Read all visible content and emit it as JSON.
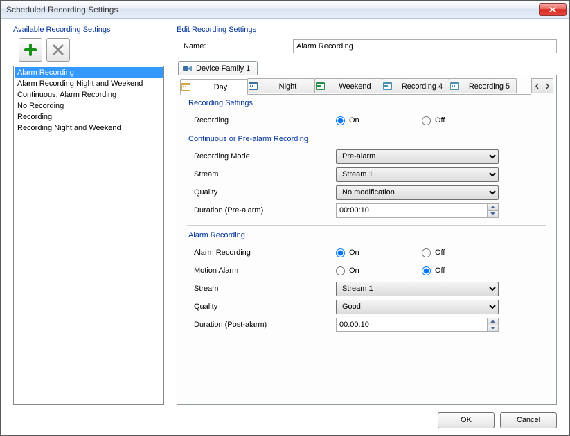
{
  "window": {
    "title": "Scheduled Recording Settings"
  },
  "left": {
    "group_title": "Available Recording Settings",
    "items": [
      "Alarm Recording",
      "Alarm Recording Night and Weekend",
      "Continuous, Alarm Recording",
      "No Recording",
      "Recording",
      "Recording Night and Weekend"
    ],
    "selected_index": 0
  },
  "edit": {
    "group_title": "Edit Recording Settings",
    "name_label": "Name:",
    "name_value": "Alarm Recording",
    "device_tab": "Device Family 1",
    "inner_tabs": [
      "Day",
      "Night",
      "Weekend",
      "Recording 4",
      "Recording 5"
    ],
    "inner_active": 0
  },
  "rec": {
    "section_title": "Recording Settings",
    "recording_label": "Recording",
    "on": "On",
    "off": "Off",
    "recording_value": "On",
    "cont_title": "Continuous or Pre-alarm Recording",
    "mode_label": "Recording Mode",
    "mode_value": "Pre-alarm",
    "stream_label": "Stream",
    "stream_value": "Stream 1",
    "quality_label": "Quality",
    "quality_value": "No modification",
    "dur_pre_label": "Duration (Pre-alarm)",
    "dur_pre_value": "00:00:10"
  },
  "alarm": {
    "section_title": "Alarm Recording",
    "alarm_rec_label": "Alarm Recording",
    "alarm_rec_value": "On",
    "motion_label": "Motion Alarm",
    "motion_value": "Off",
    "stream_label": "Stream",
    "stream_value": "Stream 1",
    "quality_label": "Quality",
    "quality_value": "Good",
    "dur_post_label": "Duration (Post-alarm)",
    "dur_post_value": "00:00:10"
  },
  "footer": {
    "ok": "OK",
    "cancel": "Cancel"
  },
  "icons": {
    "add": "plus-icon",
    "delete": "x-icon"
  }
}
